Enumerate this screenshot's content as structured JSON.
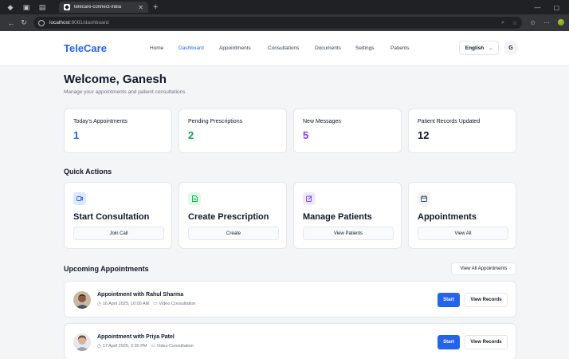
{
  "browser": {
    "tab_title": "telecare-connect-india",
    "url_host": "localhost",
    "url_path": ":8081/dashboard"
  },
  "nav": {
    "brand": "TeleCare",
    "links": [
      "Home",
      "Dashboard",
      "Appointments",
      "Consultations",
      "Documents",
      "Settings",
      "Patients"
    ],
    "active": "Dashboard",
    "language": "English",
    "avatar_initial": "G"
  },
  "welcome": {
    "title": "Welcome, Ganesh",
    "subtitle": "Manage your appointments and patient consultations"
  },
  "stats": [
    {
      "label": "Today's Appointments",
      "value": "1",
      "color": "#2563eb"
    },
    {
      "label": "Pending Prescriptions",
      "value": "2",
      "color": "#16a34a"
    },
    {
      "label": "New Messages",
      "value": "5",
      "color": "#7c3aed"
    },
    {
      "label": "Patient Records Updated",
      "value": "12",
      "color": "#111827"
    }
  ],
  "quick_actions": {
    "title": "Quick Actions",
    "items": [
      {
        "title": "Start Consultation",
        "button": "Join Call",
        "icon": "video-icon",
        "icon_bg": "#dbeafe",
        "icon_color": "#2563eb"
      },
      {
        "title": "Create Prescription",
        "button": "Create",
        "icon": "file-icon",
        "icon_bg": "#dcfce7",
        "icon_color": "#16a34a"
      },
      {
        "title": "Manage Patients",
        "button": "View Patients",
        "icon": "edit-icon",
        "icon_bg": "#ede9fe",
        "icon_color": "#7c3aed"
      },
      {
        "title": "Appointments",
        "button": "View All",
        "icon": "calendar-icon",
        "icon_bg": "#f3f4f6",
        "icon_color": "#374151"
      }
    ]
  },
  "upcoming": {
    "title": "Upcoming Appointments",
    "view_all": "View All Appointments",
    "items": [
      {
        "title": "Appointment with Rahul Sharma",
        "datetime": "16 April 2025, 10:00 AM",
        "type": "Video Consultation",
        "start": "Start",
        "records": "View Records"
      },
      {
        "title": "Appointment with Priya Patel",
        "datetime": "17 April 2025, 2:30 PM",
        "type": "Video Consultation",
        "start": "Start",
        "records": "View Records"
      }
    ]
  }
}
